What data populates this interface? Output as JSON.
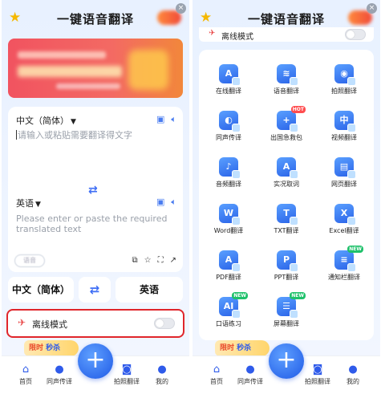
{
  "app": {
    "title": "一键语音翻译",
    "close_glyph": "×",
    "star_glyph": "★"
  },
  "left": {
    "source_lang": "中文（简体）",
    "target_lang": "英语",
    "input_placeholder": "请输入或粘贴需要翻译得文字",
    "output_placeholder": "Please enter or paste the required translated text",
    "voice_chip": "语音",
    "pill_source": "中文（简体）",
    "pill_target": "英语",
    "offline_label": "离线模式"
  },
  "nav": {
    "flash": "限时",
    "flash_b": "秒杀",
    "items": [
      "首页",
      "同声传译",
      "拍照翻译",
      "我的"
    ],
    "fab": "+"
  },
  "right": {
    "offline_label": "离线模式",
    "tools": [
      {
        "label": "在线翻译",
        "icon": "A",
        "tag": ""
      },
      {
        "label": "语音翻译",
        "icon": "≋",
        "tag": ""
      },
      {
        "label": "拍照翻译",
        "icon": "◉",
        "tag": ""
      },
      {
        "label": "同声传译",
        "icon": "◐",
        "tag": ""
      },
      {
        "label": "出国急救包",
        "icon": "+",
        "tag": "HOT"
      },
      {
        "label": "视频翻译",
        "icon": "中",
        "tag": ""
      },
      {
        "label": "音频翻译",
        "icon": "♪",
        "tag": ""
      },
      {
        "label": "实况取词",
        "icon": "A",
        "tag": ""
      },
      {
        "label": "网页翻译",
        "icon": "▤",
        "tag": ""
      },
      {
        "label": "Word翻译",
        "icon": "W",
        "tag": ""
      },
      {
        "label": "TXT翻译",
        "icon": "T",
        "tag": ""
      },
      {
        "label": "Excel翻译",
        "icon": "X",
        "tag": ""
      },
      {
        "label": "PDF翻译",
        "icon": "A",
        "tag": ""
      },
      {
        "label": "PPT翻译",
        "icon": "P",
        "tag": ""
      },
      {
        "label": "通知栏翻译",
        "icon": "≡",
        "tag": "NEW"
      },
      {
        "label": "口语练习",
        "icon": "AI",
        "tag": "NEW"
      },
      {
        "label": "屏幕翻译",
        "icon": "☰",
        "tag": "NEW"
      }
    ]
  },
  "colors": {
    "accent": "#2f5bea",
    "highlight": "#e0262b",
    "banner": "#f15360"
  }
}
